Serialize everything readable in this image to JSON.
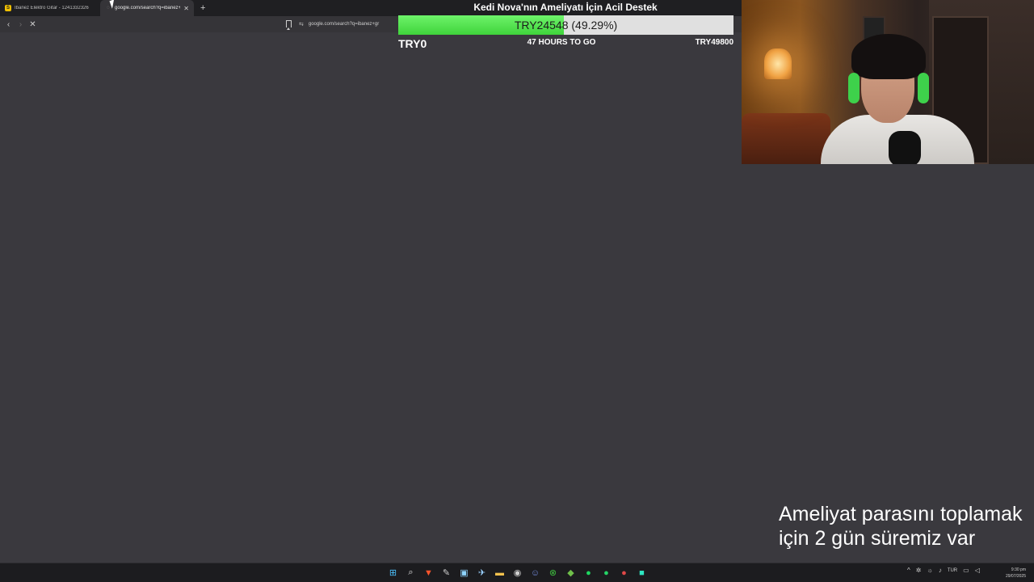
{
  "browser": {
    "tabs": [
      {
        "label": "Ibanez Elektro Gitar - 1241332326",
        "favicon": "S",
        "active": false
      },
      {
        "label": "google.com/search?q=ibanez+g",
        "favicon": "",
        "active": true
      }
    ],
    "newtab_glyph": "+",
    "url": "google.com/search?q=ibanez+gr",
    "siteinfo_glyph": "⇆"
  },
  "donation": {
    "title": "Kedi Nova'nın Ameliyatı İçin Acil Destek",
    "progress_text": "TRY24548 (49.29%)",
    "progress_fraction": 0.4929,
    "min_label": "TRY0",
    "time_left": "47 HOURS TO GO",
    "max_label": "TRY49800"
  },
  "caption": {
    "line1": "Ameliyat parasını toplamak",
    "line2": "için 2 gün süremiz var"
  },
  "taskbar": {
    "apps": [
      {
        "name": "windows-start-icon",
        "glyph": "⊞",
        "color": "#4cc2ff"
      },
      {
        "name": "search-icon",
        "glyph": "⌕",
        "color": "#e0e0e0"
      },
      {
        "name": "brave-browser-icon",
        "glyph": "▼",
        "color": "#fb542b"
      },
      {
        "name": "pen-tool-icon",
        "glyph": "✎",
        "color": "#cfcfcf"
      },
      {
        "name": "capture-tool-icon",
        "glyph": "▣",
        "color": "#8fd4ff"
      },
      {
        "name": "steam-icon",
        "glyph": "✈",
        "color": "#9ad1ff"
      },
      {
        "name": "file-explorer-icon",
        "glyph": "▬",
        "color": "#f2c14e"
      },
      {
        "name": "obs-icon",
        "glyph": "◉",
        "color": "#cfcfcf"
      },
      {
        "name": "discord-icon",
        "glyph": "☺",
        "color": "#7289da"
      },
      {
        "name": "xbox-icon",
        "glyph": "⊗",
        "color": "#3fbf3f"
      },
      {
        "name": "minecraft-icon",
        "glyph": "◆",
        "color": "#6fbf4a"
      },
      {
        "name": "spotify-icon",
        "glyph": "●",
        "color": "#1ed760"
      },
      {
        "name": "whatsapp-icon",
        "glyph": "●",
        "color": "#25d366"
      },
      {
        "name": "app-red-icon",
        "glyph": "●",
        "color": "#e04848"
      },
      {
        "name": "app-teal-icon",
        "glyph": "■",
        "color": "#2ee6c2"
      }
    ],
    "tray": {
      "chevron_glyph": "^",
      "lang": "TUR"
    },
    "clock": {
      "time": "9:30 pm",
      "date": "29/07/2025"
    }
  }
}
